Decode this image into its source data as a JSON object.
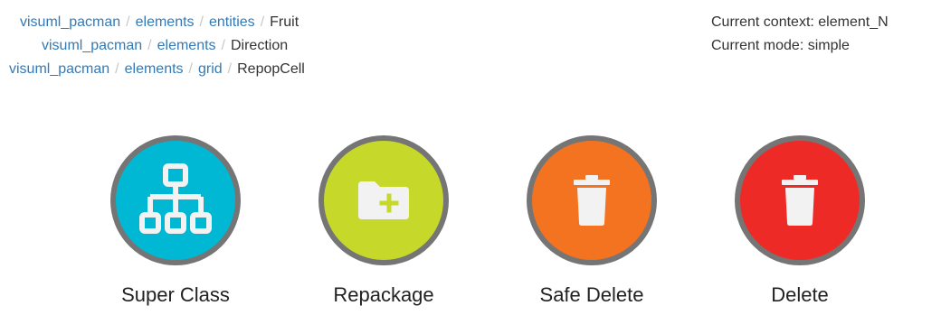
{
  "breadcrumbs": [
    {
      "links": [
        "visuml_pacman",
        "elements",
        "entities"
      ],
      "active": "Fruit"
    },
    {
      "links": [
        "visuml_pacman",
        "elements"
      ],
      "active": "Direction"
    },
    {
      "links": [
        "visuml_pacman",
        "elements",
        "grid"
      ],
      "active": "RepopCell"
    }
  ],
  "breadcrumb_separator": "/",
  "context": {
    "current_context": "Current context: element_N",
    "current_mode": "Current mode: simple"
  },
  "actions": [
    {
      "label": "Super Class",
      "icon": "hierarchy-icon",
      "color": "#00b8d4"
    },
    {
      "label": "Repackage",
      "icon": "folder-plus-icon",
      "color": "#c6d92b"
    },
    {
      "label": "Safe Delete",
      "icon": "trash-icon",
      "color": "#f47320"
    },
    {
      "label": "Delete",
      "icon": "trash-icon",
      "color": "#ee2a27"
    }
  ],
  "colors": {
    "link": "#337ab7",
    "circle_border": "#757575",
    "icon_fill": "#f2f2f2"
  }
}
